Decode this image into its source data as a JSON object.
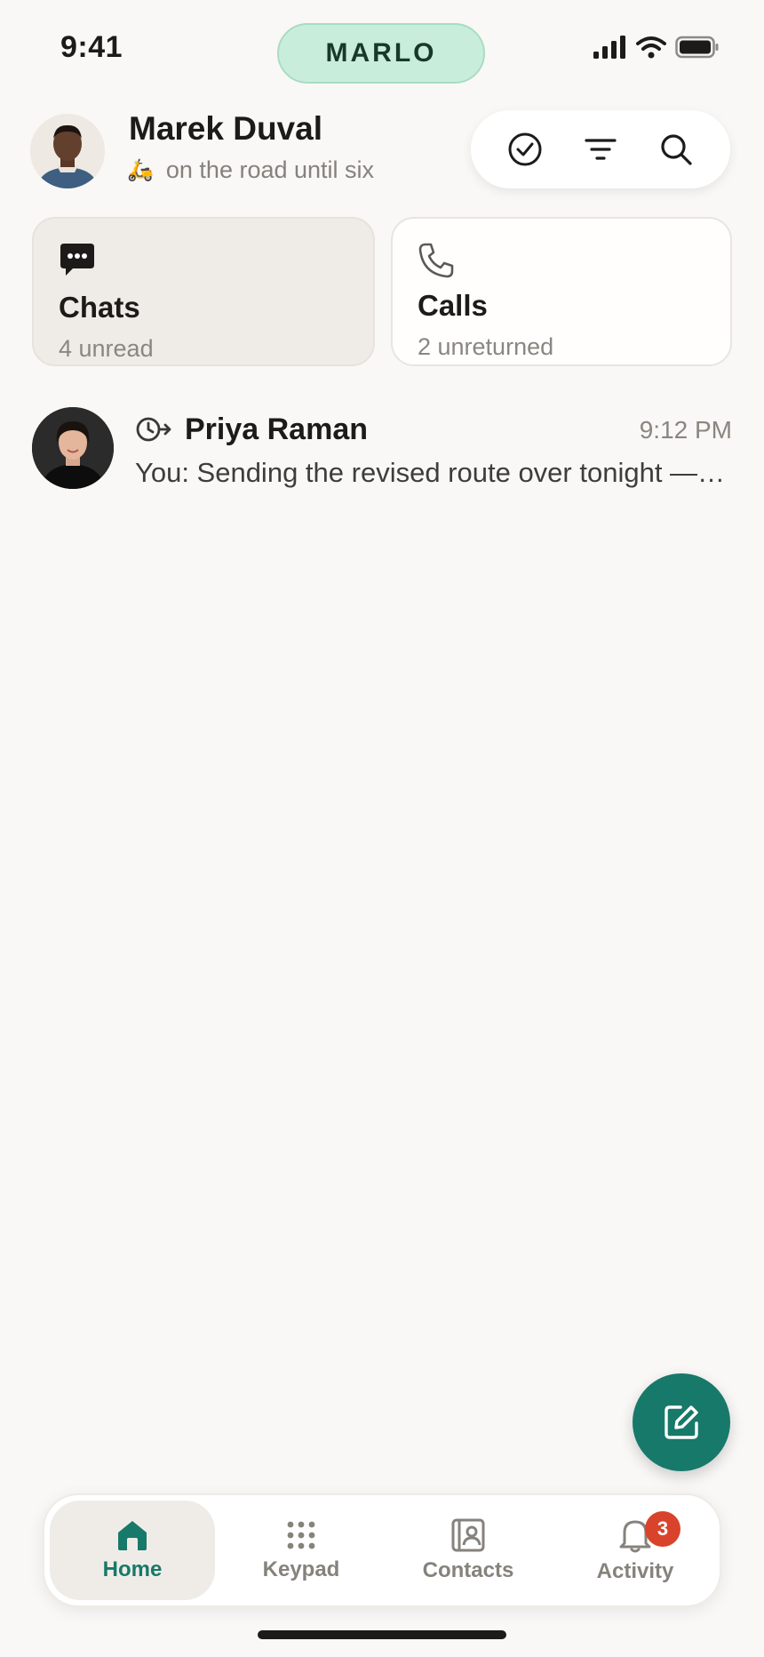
{
  "status_bar": {
    "time": "9:41",
    "brand": "MARLO"
  },
  "header": {
    "user_name": "Marek Duval",
    "status_emoji": "🛵",
    "status_text": "on the road until six",
    "actions": [
      "check-circle-icon",
      "filter-icon",
      "search-icon"
    ]
  },
  "cards": {
    "chats": {
      "title": "Chats",
      "subtitle": "4 unread"
    },
    "calls": {
      "title": "Calls",
      "subtitle": "2 unreturned"
    }
  },
  "conversations": [
    {
      "name": "Priya Raman",
      "time": "9:12 PM",
      "preview": "You: Sending the revised route over tonight —…"
    }
  ],
  "tabs": [
    {
      "label": "Home",
      "icon": "home-icon",
      "active": true
    },
    {
      "label": "Keypad",
      "icon": "keypad-icon"
    },
    {
      "label": "Contacts",
      "icon": "contacts-icon"
    },
    {
      "label": "Activity",
      "icon": "bell-icon",
      "badge": "3"
    }
  ],
  "colors": {
    "accent": "#17796a",
    "brand_pill": "#c8eedb",
    "badge": "#d9432b",
    "background": "#f9f8f6"
  }
}
